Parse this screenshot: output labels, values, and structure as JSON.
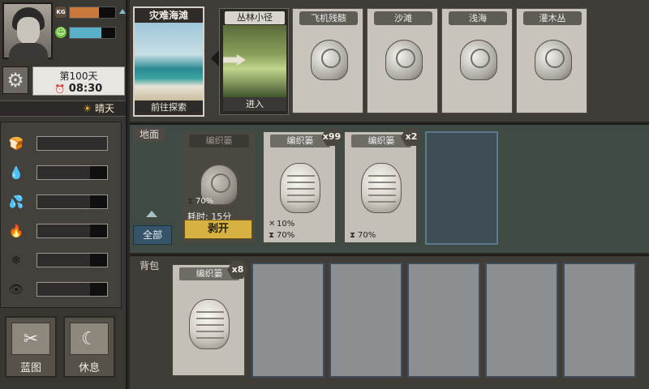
{
  "player": {
    "weight_label": "KG",
    "mood_label": "☺",
    "weight_fill_pct": 65,
    "mood_fill_pct": 70,
    "weight_color": "#c8793b",
    "mood_color": "#5ab0c8"
  },
  "clock": {
    "day": "第100天",
    "time": "08:30",
    "alarm_icon": "⏰",
    "weather": "晴天",
    "weather_icon": "☀"
  },
  "needs": [
    {
      "icon": "bread-icon",
      "glyph": "🍞",
      "level_pct": 100
    },
    {
      "icon": "water-drop-icon",
      "glyph": "💧",
      "level_pct": 75
    },
    {
      "icon": "thirst-icon",
      "glyph": "💦",
      "level_pct": 75
    },
    {
      "icon": "fire-icon",
      "glyph": "🔥",
      "level_pct": 75
    },
    {
      "icon": "snowflake-icon",
      "glyph": "❄",
      "level_pct": 75
    },
    {
      "icon": "eye-icon",
      "glyph": "👁",
      "level_pct": 75
    }
  ],
  "bottom_buttons": {
    "blueprint": "蓝图",
    "rest": "休息"
  },
  "locations": {
    "current": {
      "title": "灾难海滩",
      "action": "前往探索"
    },
    "next": {
      "title": "丛林小径",
      "action": "进入"
    },
    "found": [
      "飞机残骸",
      "沙滩",
      "浅海",
      "灌木丛"
    ]
  },
  "ground": {
    "label": "地面",
    "filter": "全部",
    "items": [
      {
        "title": "编织篓",
        "progress": "70%",
        "time_label": "耗时: 15分",
        "action": "剥开",
        "active": true
      },
      {
        "title": "编织篓",
        "count": "x99",
        "stat1": "10%",
        "stat2": "70%"
      },
      {
        "title": "编织篓",
        "count": "x2",
        "stat2": "70%"
      }
    ]
  },
  "backpack": {
    "label": "背包",
    "items": [
      {
        "title": "编织篓",
        "count": "x8"
      }
    ],
    "empty_slots": 5
  }
}
